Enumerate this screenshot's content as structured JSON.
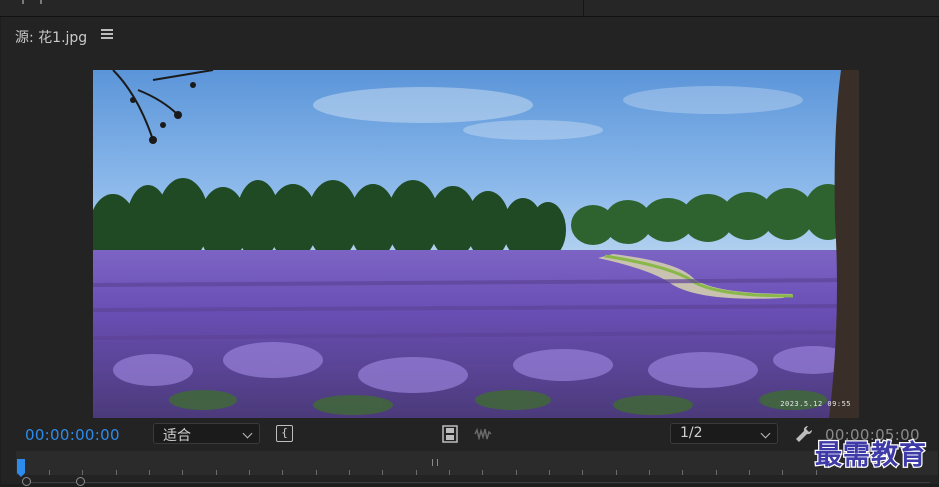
{
  "panel": {
    "title": "源: 花1.jpg"
  },
  "viewer": {
    "image_subject": "lavender field with trees and blue sky",
    "timestamp_overlay": "2023.5.12 09:55"
  },
  "controls": {
    "timecode_current": "00:00:00:00",
    "fit_select_value": "适合",
    "resolution_select_value": "1/2",
    "timecode_duration": "00:00:05:00",
    "accent_color": "#2d8ceb"
  },
  "icons": {
    "panel_menu": "hamburger-menu-icon",
    "mark_brace": "brace-icon",
    "drag_video": "film-strip-icon",
    "drag_audio": "audio-waveform-icon",
    "settings": "wrench-icon"
  },
  "watermark": {
    "text": "最需教育"
  }
}
